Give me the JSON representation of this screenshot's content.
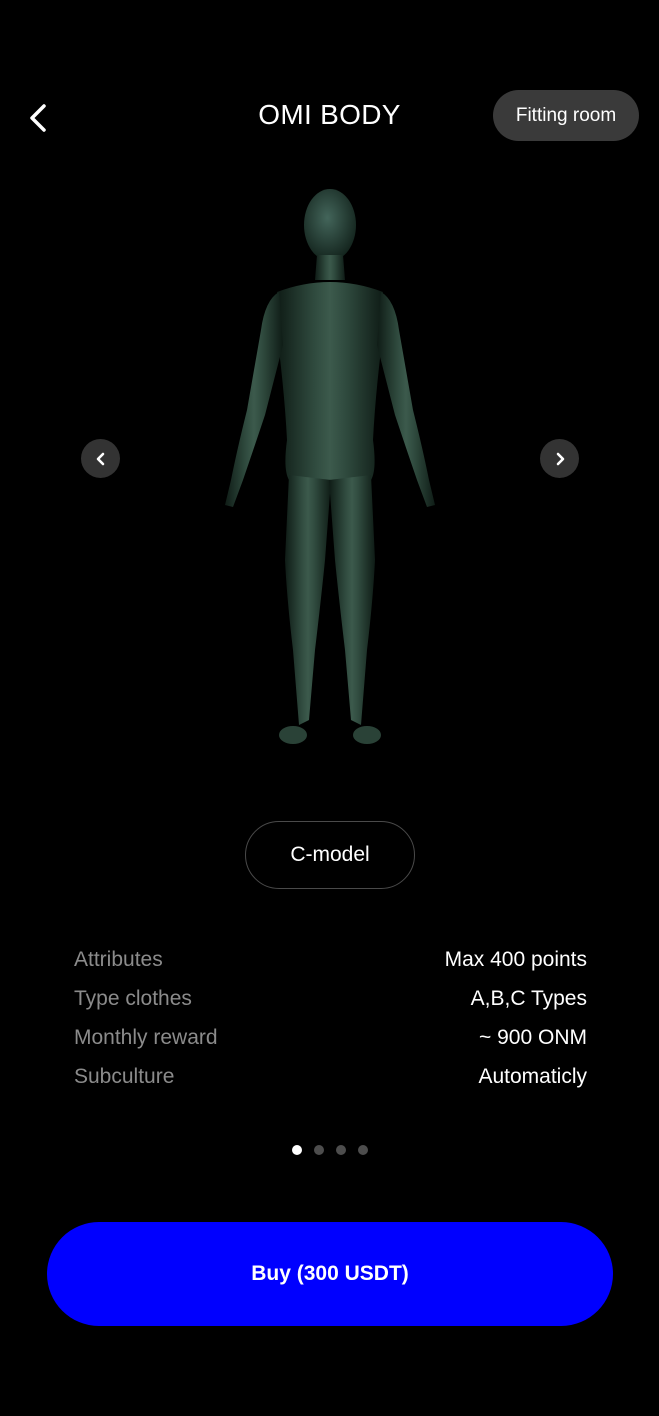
{
  "header": {
    "title": "OMI BODY",
    "fitting_room_label": "Fitting room"
  },
  "model": {
    "name": "C-model"
  },
  "attributes": [
    {
      "label": "Attributes",
      "value": "Max 400 points"
    },
    {
      "label": "Type clothes",
      "value": "A,B,C Types"
    },
    {
      "label": "Monthly reward",
      "value": "~ 900 ONM"
    },
    {
      "label": "Subculture",
      "value": "Automaticly"
    }
  ],
  "pagination": {
    "total": 4,
    "active_index": 0
  },
  "buy": {
    "label": "Buy (300 USDT)"
  },
  "colors": {
    "accent": "#0000ff",
    "figure": "#2f4a3e",
    "background": "#000000"
  },
  "icons": {
    "back": "chevron-left-icon",
    "prev": "chevron-left-icon",
    "next": "chevron-right-icon"
  }
}
